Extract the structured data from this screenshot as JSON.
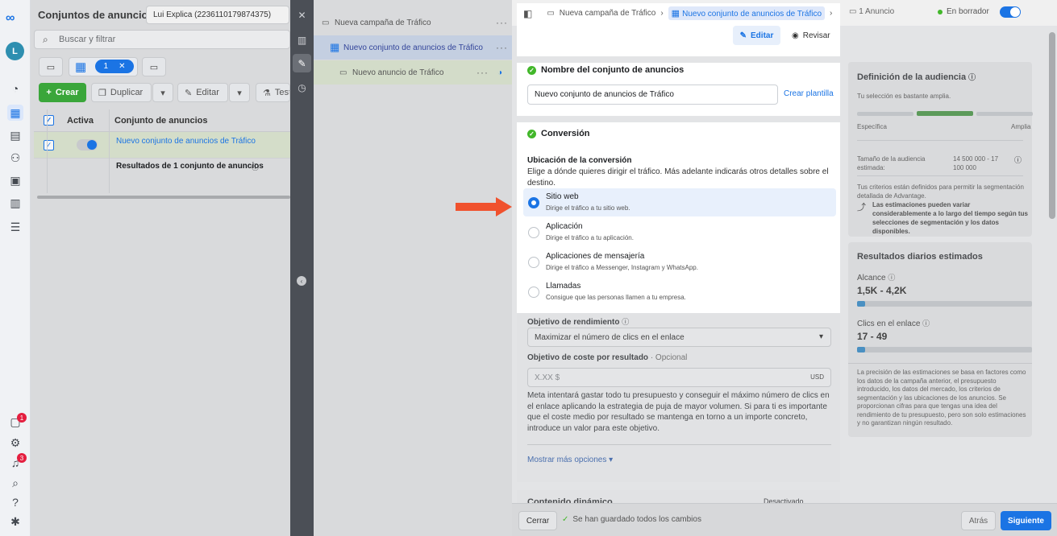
{
  "leftnav": {
    "notif_badge": "1",
    "bell_badge": "3",
    "avatar_letter": "L"
  },
  "main": {
    "title": "Conjuntos de anuncios",
    "account": "Lui Explica (2236110179874375)",
    "search_placeholder": "Buscar y filtrar",
    "selected_count": "1",
    "toolbar": {
      "create": "Crear",
      "duplicate": "Duplicar",
      "edit": "Editar",
      "test": "Test"
    },
    "columns": {
      "active": "Activa",
      "adset": "Conjunto de anuncios"
    },
    "row_name": "Nuevo conjunto de anuncios de Tráfico",
    "results_label": "Resultados de 1 conjunto de anuncios"
  },
  "tree": {
    "campaign": "Nueva campaña de Tráfico",
    "adset": "Nuevo conjunto de anuncios de Tráfico",
    "ad": "Nuevo anuncio de Tráfico"
  },
  "editor": {
    "breadcrumb_campaign": "Nueva campaña de Tráfico",
    "breadcrumb_adset": "Nuevo conjunto de anuncios de Tráfico",
    "breadcrumb_ad": "1 Anuncio",
    "draft_status": "En borrador",
    "edit_label": "Editar",
    "review_label": "Revisar",
    "name_section": "Nombre del conjunto de anuncios",
    "name_value": "Nuevo conjunto de anuncios de Tráfico",
    "template_link": "Crear plantilla",
    "conversion_section": "Conversión",
    "location_label": "Ubicación de la conversión",
    "location_help": "Elige a dónde quieres dirigir el tráfico. Más adelante indicarás otros detalles sobre el destino.",
    "options": [
      {
        "title": "Sitio web",
        "desc": "Dirige el tráfico a tu sitio web."
      },
      {
        "title": "Aplicación",
        "desc": "Dirige el tráfico a tu aplicación."
      },
      {
        "title": "Aplicaciones de mensajería",
        "desc": "Dirige el tráfico a Messenger, Instagram y WhatsApp."
      },
      {
        "title": "Llamadas",
        "desc": "Consigue que las personas llamen a tu empresa."
      }
    ],
    "performance_label": "Objetivo de rendimiento",
    "performance_value": "Maximizar el número de clics en el enlace",
    "cost_label": "Objetivo de coste por resultado",
    "cost_optional": "· Opcional",
    "cost_placeholder": "X.XX $",
    "cost_currency": "USD",
    "cost_help": "Meta intentará gastar todo tu presupuesto y conseguir el máximo número de clics en el enlace aplicando la estrategia de puja de mayor volumen. Si para ti es importante que el coste medio por resultado se mantenga en torno a un importe concreto, introduce un valor para este objetivo.",
    "more_options": "Mostrar más opciones",
    "dynamic_section": "Contenido dinámico",
    "dynamic_status": "Desactivado"
  },
  "audience": {
    "title": "Definición de la audiencia",
    "broad_note": "Tu selección es bastante amplia.",
    "specific": "Específica",
    "broad": "Amplia",
    "size_label": "Tamaño de la audiencia estimada:",
    "size_value": "14 500 000 - 17 100 000",
    "criteria_note": "Tus criterios están definidos para permitir la segmentación detallada de Advantage.",
    "variance_note": "Las estimaciones pueden variar considerablemente a lo largo del tiempo según tus selecciones de segmentación y los datos disponibles.",
    "audience_fill": 0.33
  },
  "daily": {
    "title": "Resultados diarios estimados",
    "reach_label": "Alcance",
    "reach_value": "1,5K - 4,2K",
    "clicks_label": "Clics en el enlace",
    "clicks_value": "17 - 49",
    "disclaimer": "La precisión de las estimaciones se basa en factores como los datos de la campaña anterior, el presupuesto introducido, los datos del mercado, los criterios de segmentación y las ubicaciones de los anuncios. Se proporcionan cifras para que tengas una idea del rendimiento de tu presupuesto, pero son solo estimaciones y no garantizan ningún resultado."
  },
  "footer": {
    "close": "Cerrar",
    "saved": "Se han guardado todos los cambios",
    "back": "Atrás",
    "next": "Siguiente"
  },
  "colors": {
    "accent": "#1b74e4",
    "success": "#42b72a",
    "arrow": "#f0512d"
  }
}
